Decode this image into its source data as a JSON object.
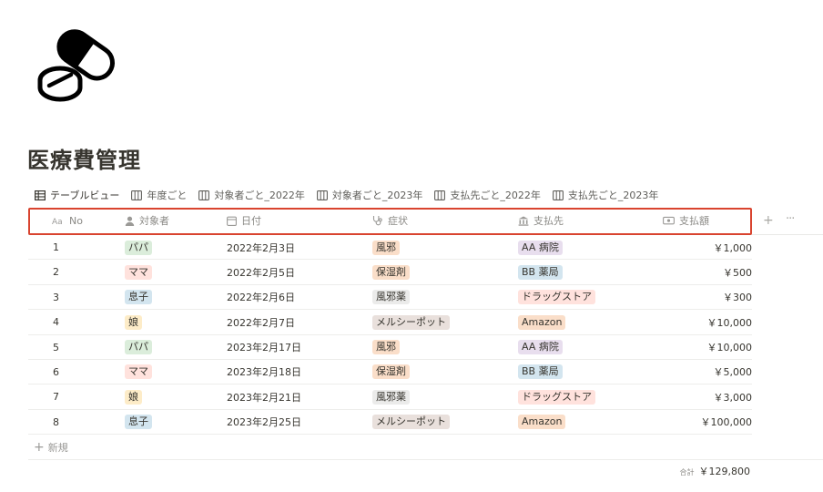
{
  "page": {
    "title": "医療費管理",
    "icon": "pill-capsule-icon"
  },
  "views": [
    {
      "label": "テーブルビュー",
      "icon": "table-icon",
      "active": true
    },
    {
      "label": "年度ごと",
      "icon": "board-icon"
    },
    {
      "label": "対象者ごと_2022年",
      "icon": "board-icon"
    },
    {
      "label": "対象者ごと_2023年",
      "icon": "board-icon"
    },
    {
      "label": "支払先ごと_2022年",
      "icon": "board-icon"
    },
    {
      "label": "支払先ごと_2023年",
      "icon": "board-icon"
    }
  ],
  "columns": {
    "no": {
      "label": "No",
      "icon": "text-aa-icon"
    },
    "person": {
      "label": "対象者",
      "icon": "person-icon"
    },
    "date": {
      "label": "日付",
      "icon": "calendar-icon"
    },
    "symptom": {
      "label": "症状",
      "icon": "stethoscope-icon"
    },
    "payee": {
      "label": "支払先",
      "icon": "building-icon"
    },
    "amount": {
      "label": "支払額",
      "icon": "money-icon"
    },
    "add_symbol": "+",
    "more_symbol": "···"
  },
  "tag_colors": {
    "パパ": "#dbeddb",
    "ママ": "#ffe2dd",
    "息子": "#d3e5ef",
    "娘": "#fdecc8",
    "風邪": "#fadec9",
    "保湿剤": "#fadec9",
    "風邪薬": "#ebebea",
    "メルシーポット": "#e9e0dc",
    "AA 病院": "#e8deee",
    "BB 薬局": "#d3e5ef",
    "ドラッグストア": "#ffe2dd",
    "Amazon": "#fadec9"
  },
  "rows": [
    {
      "no": "1",
      "person": "パパ",
      "date": "2022年2月3日",
      "symptom": "風邪",
      "payee": "AA 病院",
      "amount": "￥1,000"
    },
    {
      "no": "2",
      "person": "ママ",
      "date": "2022年2月5日",
      "symptom": "保湿剤",
      "payee": "BB 薬局",
      "amount": "￥500"
    },
    {
      "no": "3",
      "person": "息子",
      "date": "2022年2月6日",
      "symptom": "風邪薬",
      "payee": "ドラッグストア",
      "amount": "￥300"
    },
    {
      "no": "4",
      "person": "娘",
      "date": "2022年2月7日",
      "symptom": "メルシーポット",
      "payee": "Amazon",
      "amount": "￥10,000"
    },
    {
      "no": "5",
      "person": "パパ",
      "date": "2023年2月17日",
      "symptom": "風邪",
      "payee": "AA 病院",
      "amount": "￥10,000"
    },
    {
      "no": "6",
      "person": "ママ",
      "date": "2023年2月18日",
      "symptom": "保湿剤",
      "payee": "BB 薬局",
      "amount": "￥5,000"
    },
    {
      "no": "7",
      "person": "娘",
      "date": "2023年2月21日",
      "symptom": "風邪薬",
      "payee": "ドラッグストア",
      "amount": "￥3,000"
    },
    {
      "no": "8",
      "person": "息子",
      "date": "2023年2月25日",
      "symptom": "メルシーポット",
      "payee": "Amazon",
      "amount": "￥100,000"
    }
  ],
  "new_row": {
    "label": "新規",
    "icon": "plus-icon"
  },
  "summary": {
    "label": "合計",
    "value": "￥129,800"
  }
}
